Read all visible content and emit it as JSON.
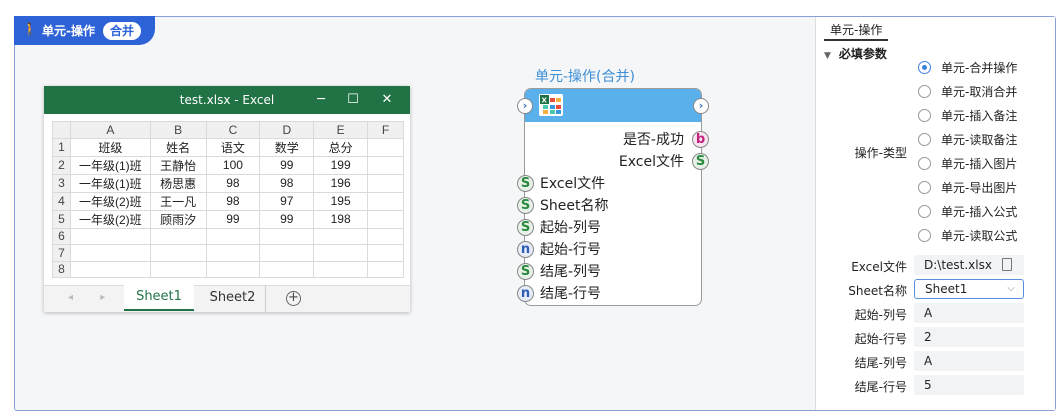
{
  "tag": {
    "label": "单元-操作",
    "pill": "合并"
  },
  "excel": {
    "title": "test.xlsx  -  Excel",
    "min": "─",
    "max": "☐",
    "close": "✕",
    "col_headers": [
      "",
      "A",
      "B",
      "C",
      "D",
      "E",
      "F"
    ],
    "rows": [
      [
        "1",
        "班级",
        "姓名",
        "语文",
        "数学",
        "总分",
        ""
      ],
      [
        "2",
        "一年级(1)班",
        "王静怡",
        "100",
        "99",
        "199",
        ""
      ],
      [
        "3",
        "一年级(1)班",
        "杨思惠",
        "98",
        "98",
        "196",
        ""
      ],
      [
        "4",
        "一年级(2)班",
        "王一凡",
        "98",
        "97",
        "195",
        ""
      ],
      [
        "5",
        "一年级(2)班",
        "顾雨汐",
        "99",
        "99",
        "198",
        ""
      ],
      [
        "6",
        "",
        "",
        "",
        "",
        "",
        ""
      ],
      [
        "7",
        "",
        "",
        "",
        "",
        "",
        ""
      ],
      [
        "8",
        "",
        "",
        "",
        "",
        "",
        ""
      ]
    ],
    "nav": "◂ ▸",
    "sheets": [
      "Sheet1",
      "Sheet2"
    ],
    "add": "+"
  },
  "node": {
    "title": "单元-操作(合并)",
    "outputs": [
      {
        "label": "是否-成功",
        "type": "b"
      },
      {
        "label": "Excel文件",
        "type": "S"
      }
    ],
    "inputs": [
      {
        "label": "Excel文件",
        "type": "S"
      },
      {
        "label": "Sheet名称",
        "type": "S"
      },
      {
        "label": "起始-列号",
        "type": "S"
      },
      {
        "label": "起始-行号",
        "type": "n"
      },
      {
        "label": "结尾-列号",
        "type": "S"
      },
      {
        "label": "结尾-行号",
        "type": "n"
      }
    ]
  },
  "panel": {
    "tab": "单元-操作",
    "section": "必填参数",
    "op_label": "操作-类型",
    "options": [
      "单元-合并操作",
      "单元-取消合并",
      "单元-插入备注",
      "单元-读取备注",
      "单元-插入图片",
      "单元-导出图片",
      "单元-插入公式",
      "单元-读取公式"
    ],
    "selected_index": 0,
    "fields": {
      "excel_label": "Excel文件",
      "excel_value": "D:\\test.xlsx",
      "sheet_label": "Sheet名称",
      "sheet_value": "Sheet1",
      "start_col_label": "起始-列号",
      "start_col_value": "A",
      "start_row_label": "起始-行号",
      "start_row_value": "2",
      "end_col_label": "结尾-列号",
      "end_col_value": "A",
      "end_row_label": "结尾-行号",
      "end_row_value": "5"
    }
  }
}
